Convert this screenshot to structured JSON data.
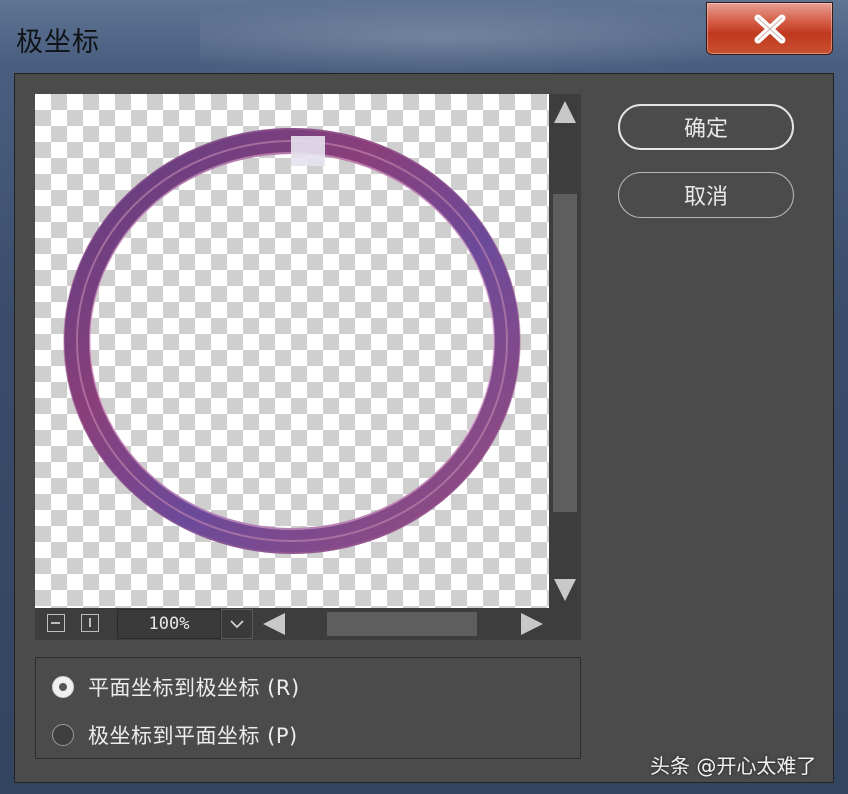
{
  "window": {
    "title": "极坐标"
  },
  "preview": {
    "zoom": "100%"
  },
  "buttons": {
    "ok_label": "确定",
    "cancel_label": "取消"
  },
  "options": [
    {
      "label": "平面坐标到极坐标 (R)",
      "selected": true
    },
    {
      "label": "极坐标到平面坐标 (P)",
      "selected": false
    }
  ],
  "watermark": "头条 @开心太难了",
  "colors": {
    "dialog_bg": "#4b4b4b",
    "close_button": "#c0391f",
    "ring": "#7a4a86"
  }
}
